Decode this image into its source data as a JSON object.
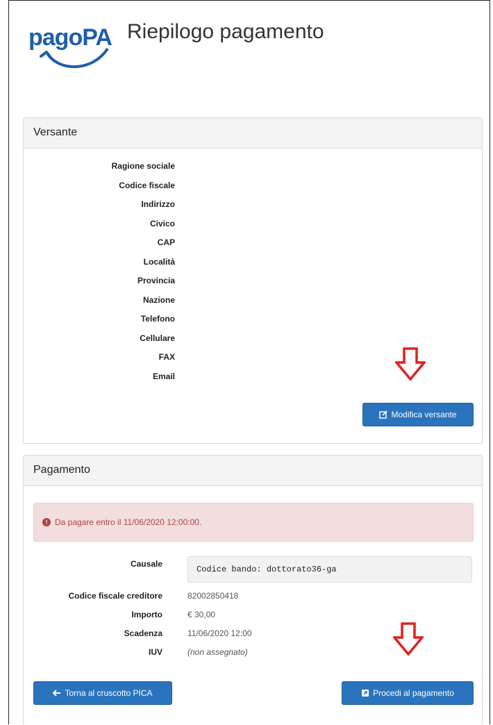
{
  "header": {
    "title": "Riepilogo pagamento",
    "logo_text": "pagoPA"
  },
  "versante": {
    "heading": "Versante",
    "fields": [
      "Ragione sociale",
      "Codice fiscale",
      "Indirizzo",
      "Civico",
      "CAP",
      "Località",
      "Provincia",
      "Nazione",
      "Telefono",
      "Cellulare",
      "FAX",
      "Email"
    ],
    "edit_button": "Modifica versante"
  },
  "pagamento": {
    "heading": "Pagamento",
    "alert": "Da pagare entro il 11/06/2020 12:00:00.",
    "causale_label": "Causale",
    "causale_value": "Codice bando: dottorato36-ga",
    "cf_creditore_label": "Codice fiscale creditore",
    "cf_creditore_value": "82002850418",
    "importo_label": "Importo",
    "importo_value": "€ 30,00",
    "scadenza_label": "Scadenza",
    "scadenza_value": "11/06/2020 12:00",
    "iuv_label": "IUV",
    "iuv_value": "(non assegnato)",
    "back_button": "Torna al cruscotto PICA",
    "proceed_button": "Procedi al pagamento"
  },
  "colors": {
    "primary": "#2a74bd",
    "alert_bg": "#f2dede",
    "alert_text": "#a94442",
    "arrow": "#e02020",
    "logo": "#1f5fa8"
  }
}
